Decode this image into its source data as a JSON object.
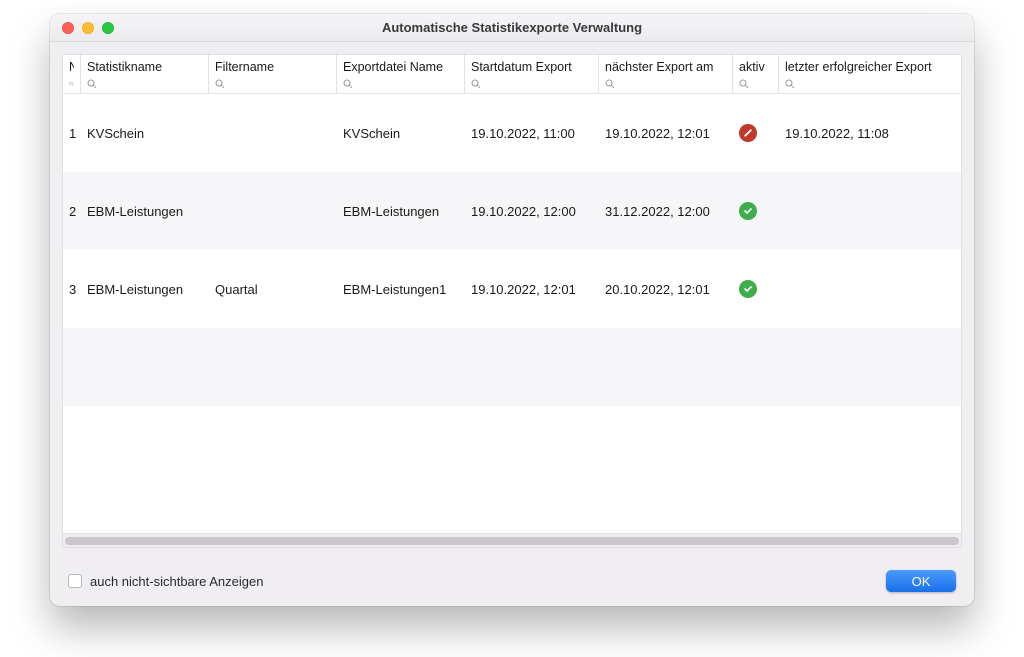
{
  "window": {
    "title": "Automatische Statistikexporte Verwaltung"
  },
  "columns": {
    "n": "N",
    "statistikname": "Statistikname",
    "filtername": "Filtername",
    "exportdatei": "Exportdatei Name",
    "startdatum": "Startdatum Export",
    "naechster": "nächster Export am",
    "aktiv": "aktiv",
    "letzter": "letzter erfolgreicher Export"
  },
  "rows": [
    {
      "n": "1",
      "statistikname": "KVSchein",
      "filtername": "",
      "exportdatei": "KVSchein",
      "startdatum": "19.10.2022, 11:00",
      "naechster": "19.10.2022, 12:01",
      "aktiv": false,
      "letzter": "19.10.2022, 11:08"
    },
    {
      "n": "2",
      "statistikname": "EBM-Leistungen",
      "filtername": "",
      "exportdatei": "EBM-Leistungen",
      "startdatum": "19.10.2022, 12:00",
      "naechster": "31.12.2022, 12:00",
      "aktiv": true,
      "letzter": ""
    },
    {
      "n": "3",
      "statistikname": "EBM-Leistungen",
      "filtername": "Quartal",
      "exportdatei": "EBM-Leistungen1",
      "startdatum": "19.10.2022, 12:01",
      "naechster": "20.10.2022, 12:01",
      "aktiv": true,
      "letzter": ""
    }
  ],
  "footer": {
    "checkbox_label": "auch nicht-sichtbare Anzeigen",
    "ok_label": "OK"
  }
}
